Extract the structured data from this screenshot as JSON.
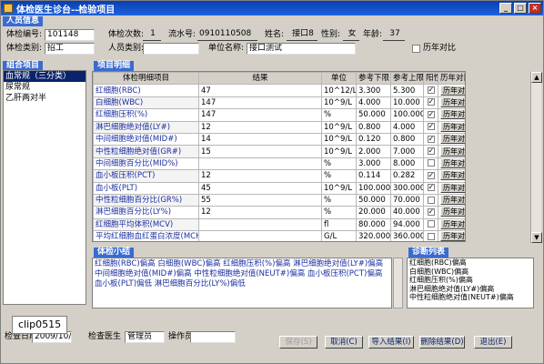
{
  "window": {
    "title": "体检医生诊台--检验项目"
  },
  "person_section": {
    "title": "人员信息"
  },
  "person": {
    "exam_no_label": "体检编号:",
    "exam_no": "101148",
    "count_label": "体检次数:",
    "count": "1",
    "serial_label": "流水号:",
    "serial": "0910110508",
    "name_label": "姓名:",
    "name": "接口8",
    "gender_label": "性别:",
    "gender": "女",
    "age_label": "年龄:",
    "age": "37",
    "category_label": "体检类别:",
    "category": "招工",
    "staff_type_label": "人员类别:",
    "staff_type": "",
    "unit_label": "单位名称:",
    "unit": "接口测试",
    "history_label": "历年对比"
  },
  "group_section": {
    "title": "组合项目"
  },
  "groups": [
    "血常规（三分类）",
    "尿常规",
    "乙肝两对半"
  ],
  "detail_section": {
    "title": "项目明细"
  },
  "grid": {
    "headers": [
      "体检明细项目",
      "结果",
      "单位",
      "参考下限",
      "参考上限",
      "阳性",
      "历年对比"
    ],
    "history_btn": "历年对比",
    "rows": [
      {
        "name": "红细胞(RBC)",
        "result": "47",
        "unit": "10^12/L",
        "low": "3.300",
        "high": "5.300",
        "pos": true
      },
      {
        "name": "白细胞(WBC)",
        "result": "147",
        "unit": "10^9/L",
        "low": "4.000",
        "high": "10.000",
        "pos": true
      },
      {
        "name": "红细胞压积(%)",
        "result": "147",
        "unit": "%",
        "low": "50.000",
        "high": "100.000",
        "pos": true
      },
      {
        "name": "淋巴细胞绝对值(LY#)",
        "result": "12",
        "unit": "10^9/L",
        "low": "0.800",
        "high": "4.000",
        "pos": true
      },
      {
        "name": "中间细胞绝对值(MID#)",
        "result": "14",
        "unit": "10^9/L",
        "low": "0.120",
        "high": "0.800",
        "pos": true
      },
      {
        "name": "中性粒细胞绝对值(GR#)",
        "result": "15",
        "unit": "10^9/L",
        "low": "2.000",
        "high": "7.000",
        "pos": true
      },
      {
        "name": "中间细胞百分比(MID%)",
        "result": "",
        "unit": "%",
        "low": "3.000",
        "high": "8.000",
        "pos": false
      },
      {
        "name": "血小板压积(PCT)",
        "result": "12",
        "unit": "%",
        "low": "0.114",
        "high": "0.282",
        "pos": true
      },
      {
        "name": "血小板(PLT)",
        "result": "45",
        "unit": "10^9/L",
        "low": "100.000",
        "high": "300.000",
        "pos": true
      },
      {
        "name": "中性粒细胞百分比(GR%)",
        "result": "55",
        "unit": "%",
        "low": "50.000",
        "high": "70.000",
        "pos": false
      },
      {
        "name": "淋巴细胞百分比(LY%)",
        "result": "12",
        "unit": "%",
        "low": "20.000",
        "high": "40.000",
        "pos": true
      },
      {
        "name": "红细胞平均体积(MCV)",
        "result": "",
        "unit": "fl",
        "low": "80.000",
        "high": "94.000",
        "pos": false
      },
      {
        "name": "平均红细胞血红蛋白浓度(MCHC)",
        "result": "",
        "unit": "G/L",
        "low": "320.000",
        "high": "360.000",
        "pos": false
      }
    ]
  },
  "summary_section": {
    "title": "体检小结"
  },
  "summary_text": "红细胞(RBC)偏高  白细胞(WBC)偏高  红细胞压积(%)偏高  淋巴细胞绝对值(LY#)偏高  中间细胞绝对值(MID#)偏高  中性粒细胞绝对值(NEUT#)偏高  血小板压积(PCT)偏高  血小板(PLT)偏低  淋巴细胞百分比(LY%)偏低",
  "diag_section": {
    "title": "诊断列表"
  },
  "diagnoses": [
    "红细胞(RBC)偏高",
    "白细胞(WBC)偏高",
    "红细胞压积(%)偏高",
    "淋巴细胞绝对值(LY#)偏高",
    "中性粒细胞绝对值(NEUT#)偏高"
  ],
  "bottom": {
    "date_label": "检查日期",
    "date": "2009/10/12",
    "doctor_label": "检查医生",
    "doctor": "管理员",
    "operator_label": "操作员",
    "operator": ""
  },
  "buttons": {
    "save": "保存(S)",
    "cancel": "取消(C)",
    "import": "导入结果(I)",
    "delete": "删除结果(D)",
    "exit": "退出(E)"
  },
  "overlay": {
    "clip": "clip0515"
  }
}
